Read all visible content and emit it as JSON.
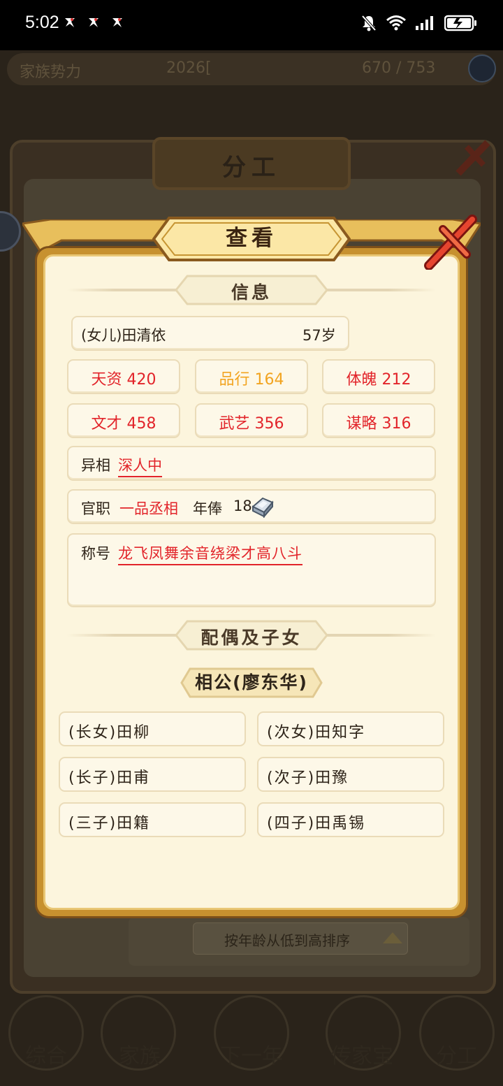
{
  "status_bar": {
    "time": "5:02",
    "notification_icons": [
      "app-notif-icon",
      "app-notif-icon",
      "app-notif-icon"
    ],
    "right_icons": [
      "mute-bell-icon",
      "wifi-icon",
      "signal-icon",
      "battery-icon"
    ]
  },
  "background": {
    "topbar": {
      "left_text": "家族势力",
      "mid_text": "2026[",
      "right_text": "670 / 753"
    },
    "panel_title": "分工",
    "sort_label": "按年龄从低到高排序",
    "nav": [
      "综合",
      "家族",
      "下一年",
      "传家宝",
      "分工"
    ]
  },
  "dialog": {
    "title": "查看",
    "info_section": "信息",
    "person": {
      "name": "(女儿)田清依",
      "age": "57岁"
    },
    "stats": [
      {
        "label": "天资",
        "value": "420",
        "color": "#e2242a"
      },
      {
        "label": "品行",
        "value": "164",
        "color": "#f2a420"
      },
      {
        "label": "体魄",
        "value": "212",
        "color": "#e2242a"
      },
      {
        "label": "文才",
        "value": "458",
        "color": "#e2242a"
      },
      {
        "label": "武艺",
        "value": "356",
        "color": "#e2242a"
      },
      {
        "label": "谋略",
        "value": "316",
        "color": "#e2242a"
      }
    ],
    "trait": {
      "label": "异相",
      "value": "深人中"
    },
    "office": {
      "label": "官职",
      "rank": "一品丞相",
      "salary_label": "年俸",
      "salary_value": "18",
      "salary_icon": "silver-ingot-icon"
    },
    "titles": {
      "label": "称号",
      "value": "龙飞凤舞余音绕梁才高八斗"
    },
    "family_section": "配偶及子女",
    "spouse": "相公(廖东华)",
    "children": [
      "(长女)田柳",
      "(次女)田知字",
      "(长子)田甫",
      "(次子)田豫",
      "(三子)田籍",
      "(四子)田禹锡"
    ]
  },
  "colors": {
    "accent_red": "#e2242a",
    "accent_orange": "#f2a420",
    "dialog_gold": "#c7912f",
    "panel_cream": "#fcf5dd"
  }
}
